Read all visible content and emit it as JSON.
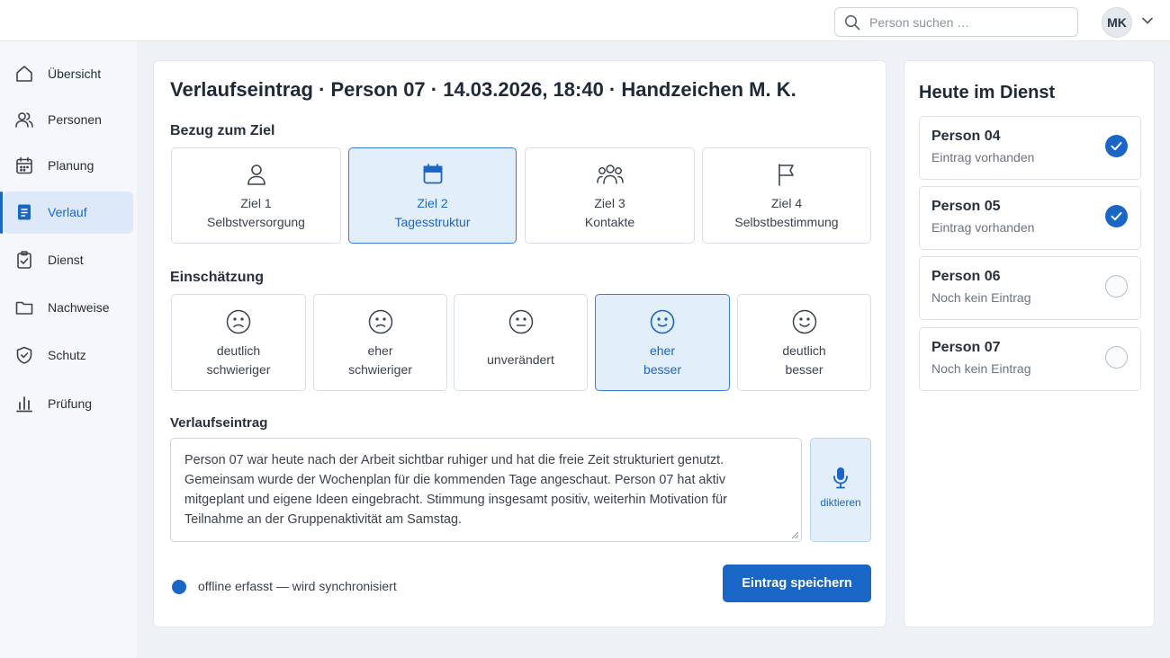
{
  "topbar": {
    "search_placeholder": "Person suchen …",
    "user_initials": "MK"
  },
  "sidebar": {
    "items": [
      {
        "label": "Übersicht",
        "icon": "home-icon"
      },
      {
        "label": "Personen",
        "icon": "users-icon"
      },
      {
        "label": "Planung",
        "icon": "calendar-icon"
      },
      {
        "label": "Verlauf",
        "icon": "document-icon",
        "active": true
      },
      {
        "label": "Dienst",
        "icon": "clipboard-check-icon"
      },
      {
        "label": "Nachweise",
        "icon": "folder-icon"
      },
      {
        "label": "Schutz",
        "icon": "shield-check-icon"
      },
      {
        "label": "Prüfung",
        "icon": "bar-chart-icon"
      }
    ]
  },
  "main": {
    "title": "Verlaufseintrag · Person 07 · 14.03.2026, 18:40 · Handzeichen M. K.",
    "goal_section_label": "Bezug zum Ziel",
    "goals": [
      {
        "line1": "Ziel 1",
        "line2": "Selbstversorgung",
        "icon": "person-icon"
      },
      {
        "line1": "Ziel 2",
        "line2": "Tagesstruktur",
        "icon": "calendar-icon",
        "selected": true
      },
      {
        "line1": "Ziel 3",
        "line2": "Kontakte",
        "icon": "group-icon"
      },
      {
        "line1": "Ziel 4",
        "line2": "Selbstbestimmung",
        "icon": "flag-icon"
      }
    ],
    "rating_section_label": "Einschätzung",
    "ratings": [
      {
        "line1": "deutlich",
        "line2": "schwieriger",
        "icon": "frown-icon"
      },
      {
        "line1": "eher",
        "line2": "schwieriger",
        "icon": "frown-icon"
      },
      {
        "line1": "unverändert",
        "line2": "",
        "icon": "neutral-face-icon"
      },
      {
        "line1": "eher",
        "line2": "besser",
        "icon": "smile-icon",
        "selected": true
      },
      {
        "line1": "deutlich",
        "line2": "besser",
        "icon": "smile-icon"
      }
    ],
    "entry_label": "Verlaufseintrag",
    "entry_text": "Person 07 war heute nach der Arbeit sichtbar ruhiger und hat die freie Zeit strukturiert genutzt. Gemeinsam wurde der Wochenplan für die kommenden Tage angeschaut. Person 07 hat aktiv mitgeplant und eigene Ideen eingebracht. Stimmung insgesamt positiv, weiterhin Motivation für Teilnahme an der Gruppenaktivität am Samstag.",
    "dictate_label": "diktieren",
    "sync_status": "offline erfasst — wird synchronisiert",
    "save_label": "Eintrag speichern"
  },
  "right": {
    "title": "Heute im Dienst",
    "persons": [
      {
        "name": "Person 04",
        "status": "Eintrag vorhanden",
        "done": true
      },
      {
        "name": "Person 05",
        "status": "Eintrag vorhanden",
        "done": true
      },
      {
        "name": "Person 06",
        "status": "Noch kein Eintrag",
        "done": false
      },
      {
        "name": "Person 07",
        "status": "Noch kein Eintrag",
        "done": false
      }
    ]
  },
  "colors": {
    "accent": "#1a66c7",
    "selected_bg": "#e3eefb",
    "page_bg": "#eef1f5"
  }
}
